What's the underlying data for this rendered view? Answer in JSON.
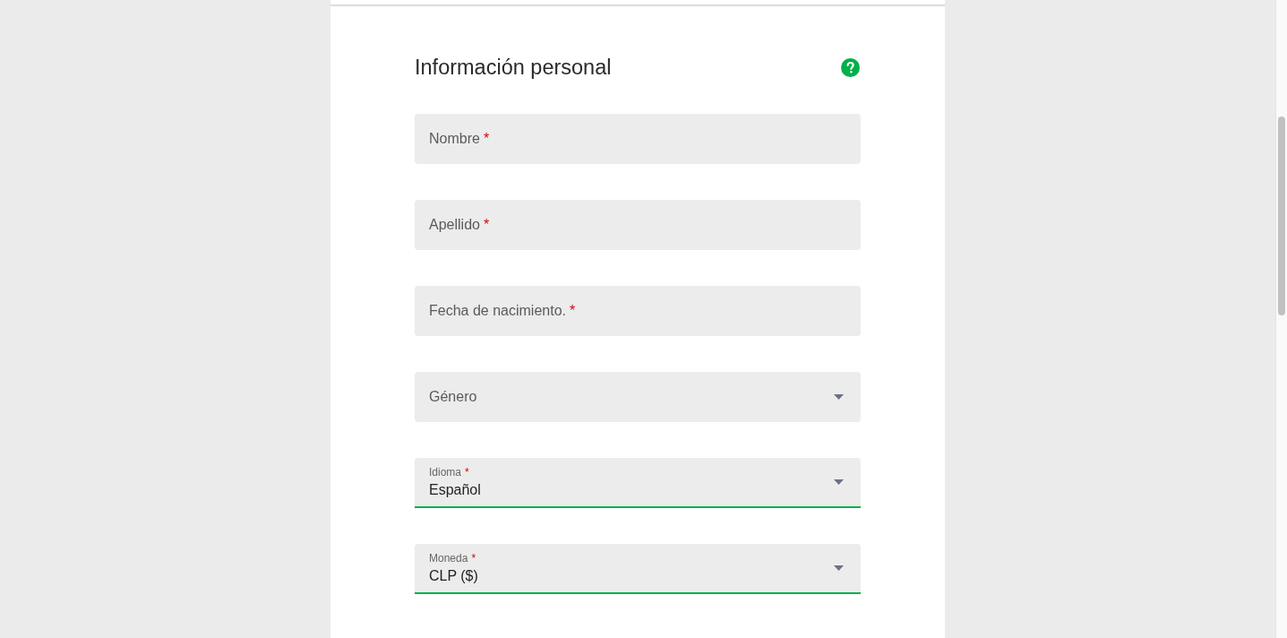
{
  "heading": "Información personal",
  "fields": [
    {
      "kind": "text",
      "label": "Nombre",
      "required_mark": "*",
      "valid": false
    },
    {
      "kind": "text",
      "label": "Apellido",
      "required_mark": "*",
      "valid": false
    },
    {
      "kind": "text",
      "label": "Fecha de nacimiento.",
      "required_mark": "*",
      "valid": false
    },
    {
      "kind": "select",
      "label": "Género",
      "valid": false
    },
    {
      "kind": "select",
      "label": "Idioma",
      "required_mark": "*",
      "value": "Español",
      "valid": true
    },
    {
      "kind": "select",
      "label": "Moneda",
      "required_mark": "*",
      "value": "CLP ($)",
      "valid": true
    }
  ]
}
